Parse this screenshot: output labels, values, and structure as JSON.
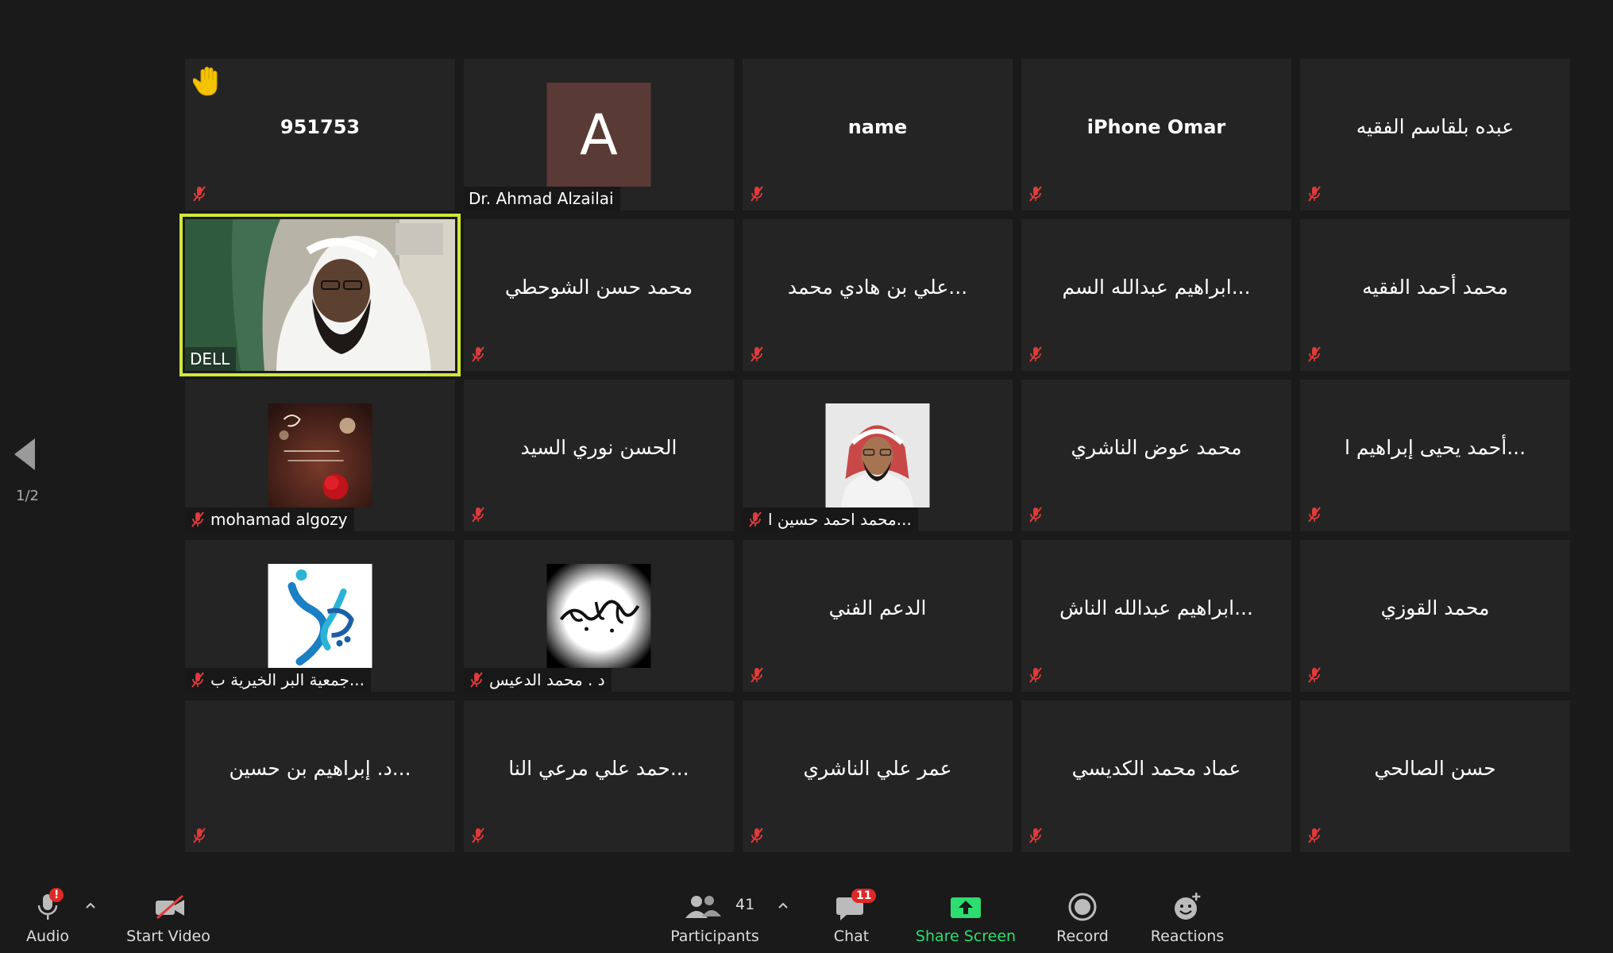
{
  "tiles": [
    {
      "name": "951753",
      "kind": "center",
      "raised_hand": true
    },
    {
      "name": "Dr. Ahmad Alzailai",
      "kind": "avatar-letter",
      "letter": "A",
      "avatar_color": "#5a3a34"
    },
    {
      "name": "name",
      "kind": "center"
    },
    {
      "name": "iPhone Omar",
      "kind": "center"
    },
    {
      "name": "عبده بلقاسم الفقيه",
      "kind": "center"
    },
    {
      "name": "DELL",
      "kind": "video",
      "speaking": true
    },
    {
      "name": "محمد حسن الشوحطي",
      "kind": "center"
    },
    {
      "name": "...علي بن هادي محمد",
      "kind": "center"
    },
    {
      "name": "...ابراهيم عبدالله السم",
      "kind": "center"
    },
    {
      "name": "محمد أحمد الفقيه",
      "kind": "center"
    },
    {
      "name": "mohamad algozy",
      "kind": "picture",
      "picture": "rose-image"
    },
    {
      "name": "الحسن نوري السيد",
      "kind": "center"
    },
    {
      "name": "...محمد احمد حسين ا",
      "kind": "picture",
      "picture": "portrait-photo"
    },
    {
      "name": "محمد عوض الناشري",
      "kind": "center"
    },
    {
      "name": "...أحمد يحيى إبراهيم ا",
      "kind": "center"
    },
    {
      "name": "...جمعية البر الخيرية ب",
      "kind": "picture",
      "picture": "charity-logo"
    },
    {
      "name": "د . محمد  الدعيس",
      "kind": "picture",
      "picture": "calligraphy-logo"
    },
    {
      "name": "الدعم الفني",
      "kind": "center"
    },
    {
      "name": "...ابراهيم عبدالله الناش",
      "kind": "center"
    },
    {
      "name": "محمد القوزي",
      "kind": "center"
    },
    {
      "name": "...د. إبراهيم بن حسين",
      "kind": "center"
    },
    {
      "name": "...حمد علي مرعي النا",
      "kind": "center"
    },
    {
      "name": "عمر علي الناشري",
      "kind": "center"
    },
    {
      "name": "عماد  محمد الكديسي",
      "kind": "center"
    },
    {
      "name": "حسن الصالحي",
      "kind": "center"
    }
  ],
  "page_indicator": "1/2",
  "toolbar": {
    "audio_label": "Audio",
    "audio_badge": "!",
    "video_label": "Start Video",
    "participants_label": "Participants",
    "participants_count": "41",
    "chat_label": "Chat",
    "chat_badge": "11",
    "share_label": "Share Screen",
    "record_label": "Record",
    "reactions_label": "Reactions"
  },
  "colors": {
    "speaking_border": "#cfe83a",
    "mute_icon": "#e03a3a",
    "share_green": "#2ddd6f",
    "badge_red": "#e02828"
  }
}
